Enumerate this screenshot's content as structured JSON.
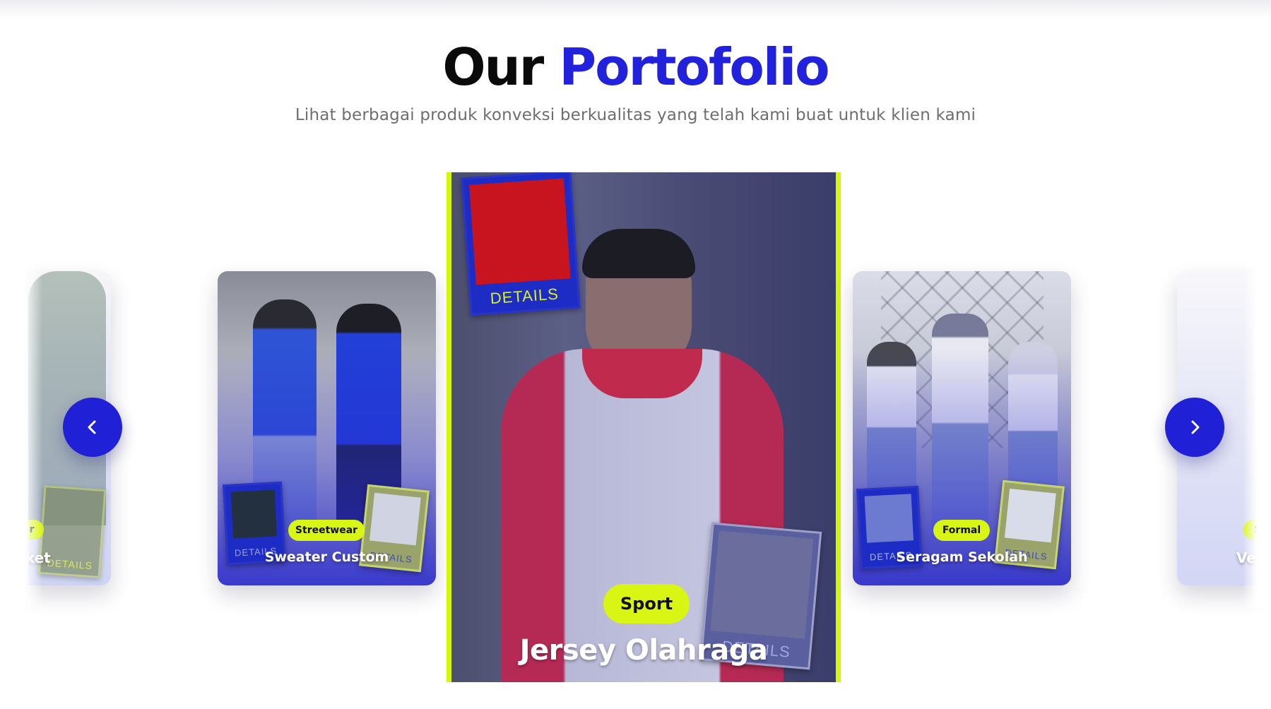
{
  "section": {
    "title_part1": "Our",
    "title_part2": "Portofolio",
    "subtitle": "Lihat berbagai produk konveksi berkualitas yang telah kami buat untuk klien kami"
  },
  "colors": {
    "accent_blue": "#2222dd",
    "accent_lime": "#d9f514"
  },
  "carousel": {
    "prev_icon": "chevron-left-icon",
    "next_icon": "chevron-right-icon",
    "detail_label": "DETAILS",
    "cards": [
      {
        "tag": "r",
        "title": "cket"
      },
      {
        "tag": "Streetwear",
        "title": "Sweater Custom"
      },
      {
        "tag": "Sport",
        "title": "Jersey Olahraga"
      },
      {
        "tag": "Formal",
        "title": "Seragam Sekolah"
      },
      {
        "tag": "S",
        "title": "Ves"
      }
    ]
  }
}
